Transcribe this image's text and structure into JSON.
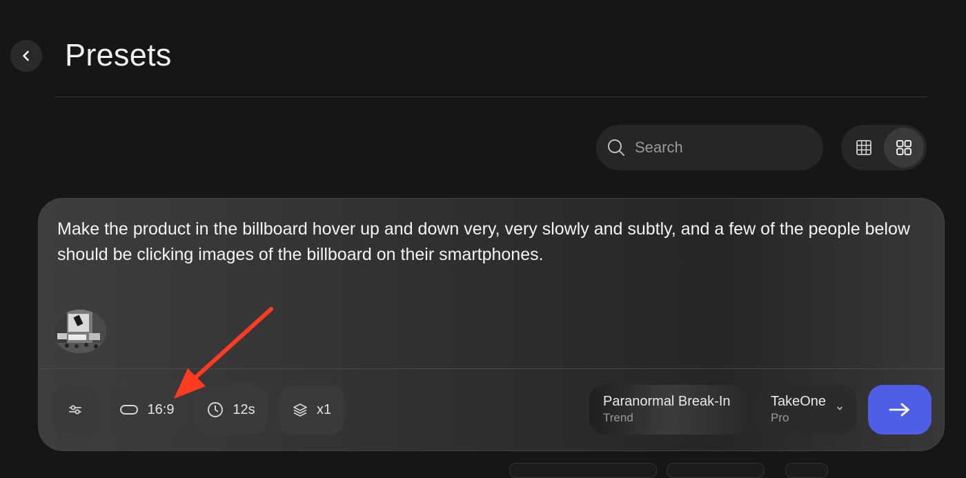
{
  "header": {
    "title": "Presets"
  },
  "search": {
    "placeholder": "Search"
  },
  "view_toggle": {
    "options": [
      "table-grid",
      "card-grid"
    ],
    "active": "card-grid"
  },
  "composer": {
    "prompt": "Make the product in the billboard hover up and down very, very slowly and subtly, and a few of the people below should be clicking images of the billboard on their smartphones.",
    "controls": {
      "aspect_ratio": "16:9",
      "duration": "12s",
      "count": "x1"
    },
    "preset": {
      "title": "Paranormal Break-In",
      "subtitle": "Trend"
    },
    "model": {
      "title": "TakeOne",
      "subtitle": "Pro"
    }
  },
  "colors": {
    "background": "#161616",
    "accent": "#4e5ee6",
    "annotation_arrow": "#ff3b22"
  },
  "icons": {
    "back": "chevron-left-icon",
    "search": "search-icon",
    "settings": "sliders-icon",
    "aspect": "aspect-ratio-icon",
    "duration": "clock-icon",
    "count": "layers-icon",
    "send": "arrow-right-icon"
  }
}
